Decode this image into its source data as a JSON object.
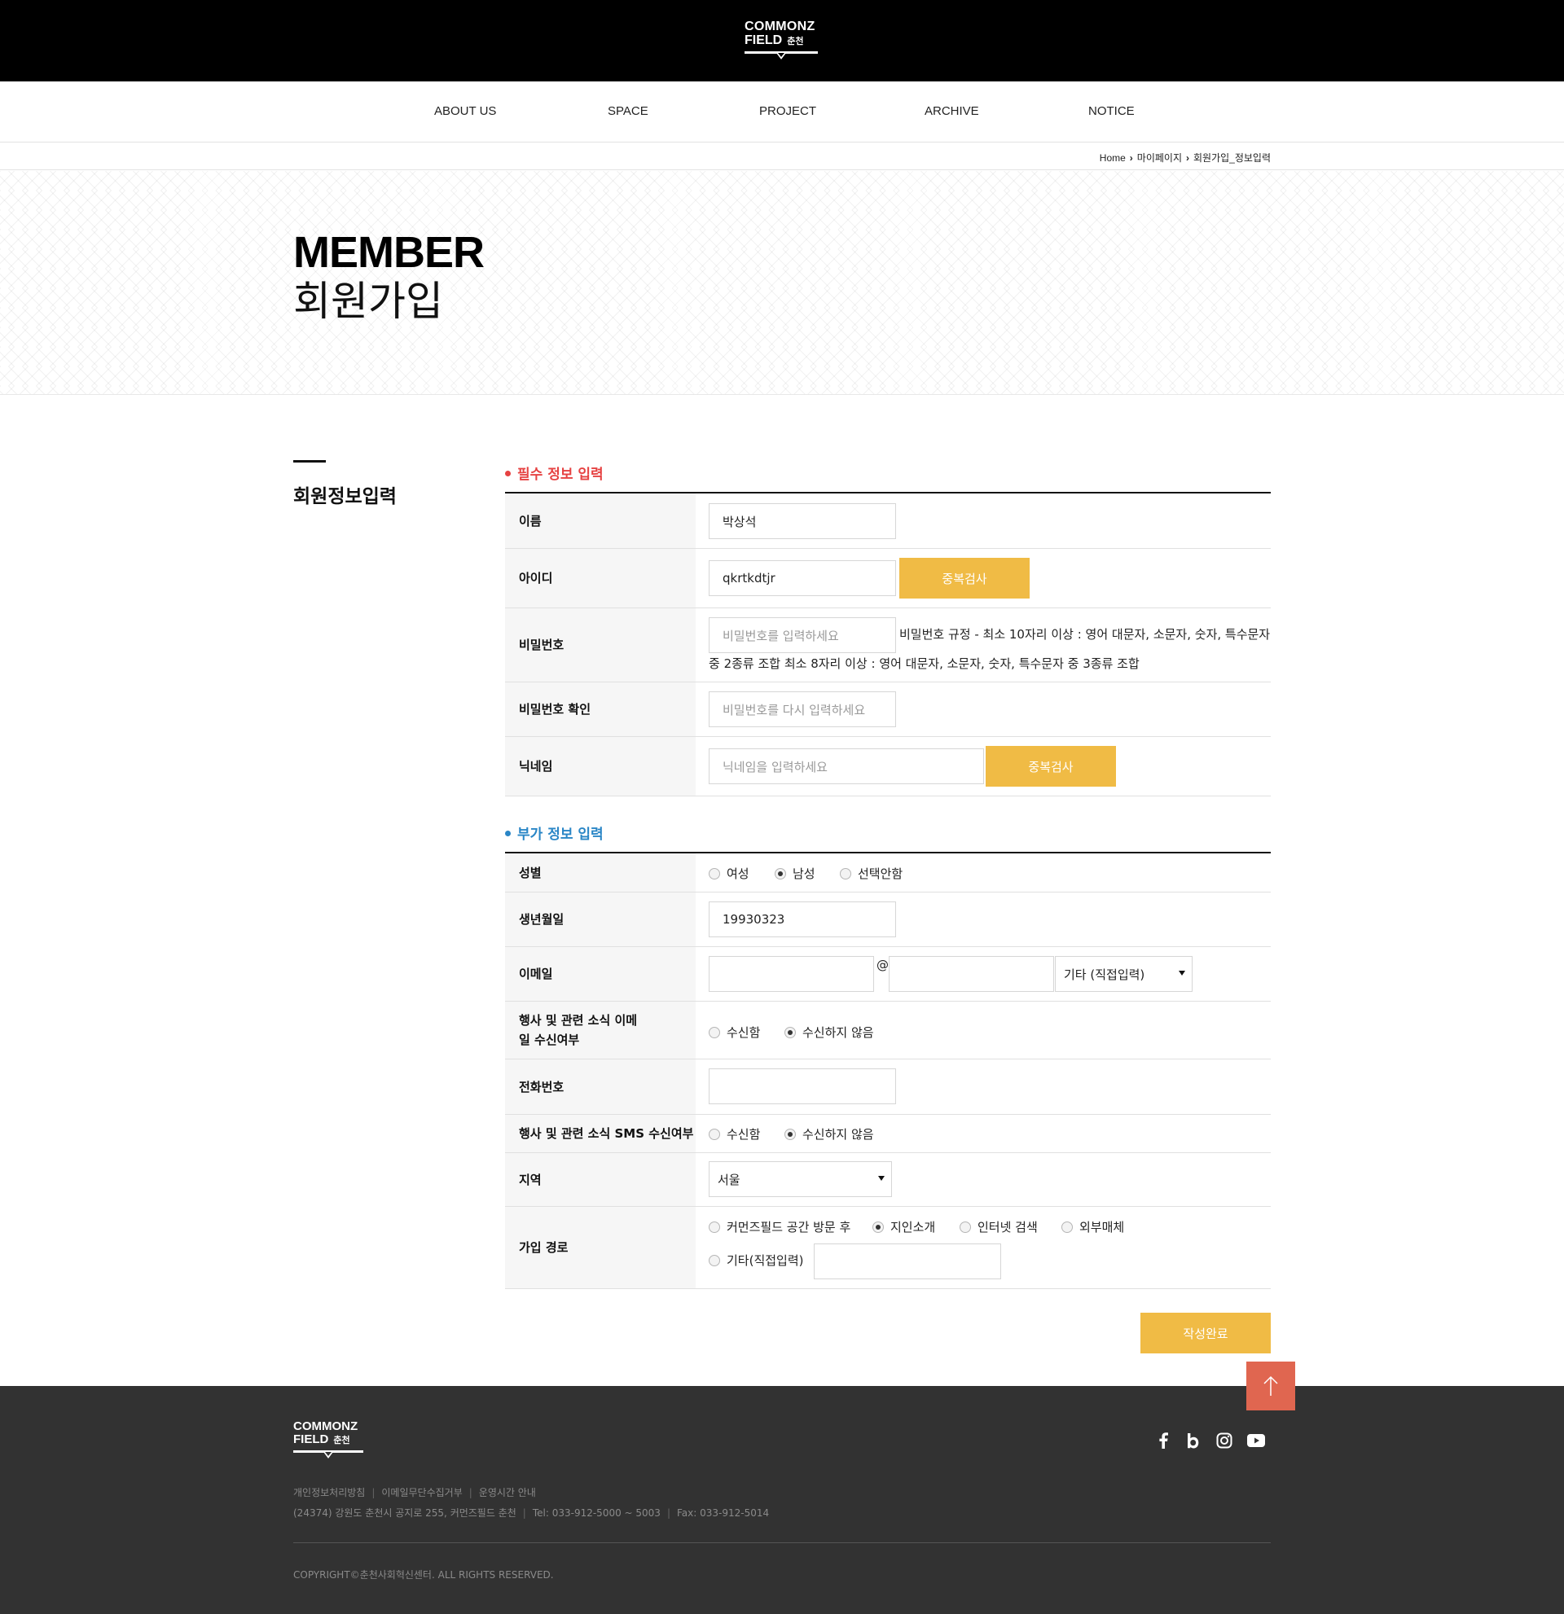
{
  "header": {
    "logo_line1": "COMMONZ",
    "logo_line2": "FIELD",
    "logo_ko": "춘천"
  },
  "nav": [
    {
      "label": "ABOUT US"
    },
    {
      "label": "SPACE"
    },
    {
      "label": "PROJECT"
    },
    {
      "label": "ARCHIVE"
    },
    {
      "label": "NOTICE"
    }
  ],
  "breadcrumb": [
    "Home",
    "마이페이지",
    "회원가입_정보입력"
  ],
  "hero": {
    "title_en": "MEMBER",
    "title_ko": "회원가입"
  },
  "side_title": "회원정보입력",
  "required": {
    "title": "필수 정보 입력",
    "name_label": "이름",
    "name_value": "박상석",
    "id_label": "아이디",
    "id_value": "qkrtkdtjr",
    "id_check": "중복검사",
    "pw_label": "비밀번호",
    "pw_placeholder": "비밀번호를 입력하세요",
    "pw_note1": "비밀번호 규정 - 최소 10자리 이상 : 영어 대문자, 소문자, 숫자, 특수문자",
    "pw_note2": "중 2종류 조합 최소 8자리 이상 : 영어 대문자, 소문자, 숫자, 특수문자 중 3종류 조합",
    "pw2_label": "비밀번호 확인",
    "pw2_placeholder": "비밀번호를 다시 입력하세요",
    "nick_label": "닉네임",
    "nick_placeholder": "닉네임을 입력하세요",
    "nick_check": "중복검사"
  },
  "optional": {
    "title": "부가 정보 입력",
    "gender_label": "성별",
    "gender_options": [
      "여성",
      "남성",
      "선택안함"
    ],
    "gender_selected": "남성",
    "birth_label": "생년월일",
    "birth_value": "19930323",
    "email_label": "이메일",
    "email_at": "@",
    "email_domain_select": "기타 (직접입력)",
    "email_news_label": "행사 및 관련 소식 이메일 수신여부",
    "email_news_options": [
      "수신함",
      "수신하지 않음"
    ],
    "email_news_selected": "수신하지 않음",
    "phone_label": "전화번호",
    "sms_label": "행사 및 관련 소식 SMS 수신여부",
    "sms_options": [
      "수신함",
      "수신하지 않음"
    ],
    "sms_selected": "수신하지 않음",
    "region_label": "지역",
    "region_value": "서울",
    "route_label": "가입 경로",
    "route_options": [
      "커먼즈필드 공간 방문 후",
      "지인소개",
      "인터넷 검색",
      "외부매체",
      "기타(직접입력)"
    ],
    "route_selected": "지인소개"
  },
  "submit_label": "작성완료",
  "footer": {
    "logo_line1": "COMMONZ",
    "logo_line2": "FIELD",
    "logo_ko": "춘천",
    "links": [
      "개인정보처리방침",
      "이메일무단수집거부",
      "운영시간 안내"
    ],
    "address": "(24374) 강원도 춘천시 공지로 255, 커먼즈필드 춘천",
    "tel": "Tel: 033-912-5000 ~ 5003",
    "fax": "Fax: 033-912-5014",
    "copyright": "COPYRIGHT©춘천사회혁신센터. ALL RIGHTS RESERVED."
  },
  "colors": {
    "accent_yellow": "#f0bb45",
    "required_red": "#e64242",
    "optional_blue": "#2a86c6",
    "top_button": "#e06650",
    "footer_bg": "#323232"
  }
}
